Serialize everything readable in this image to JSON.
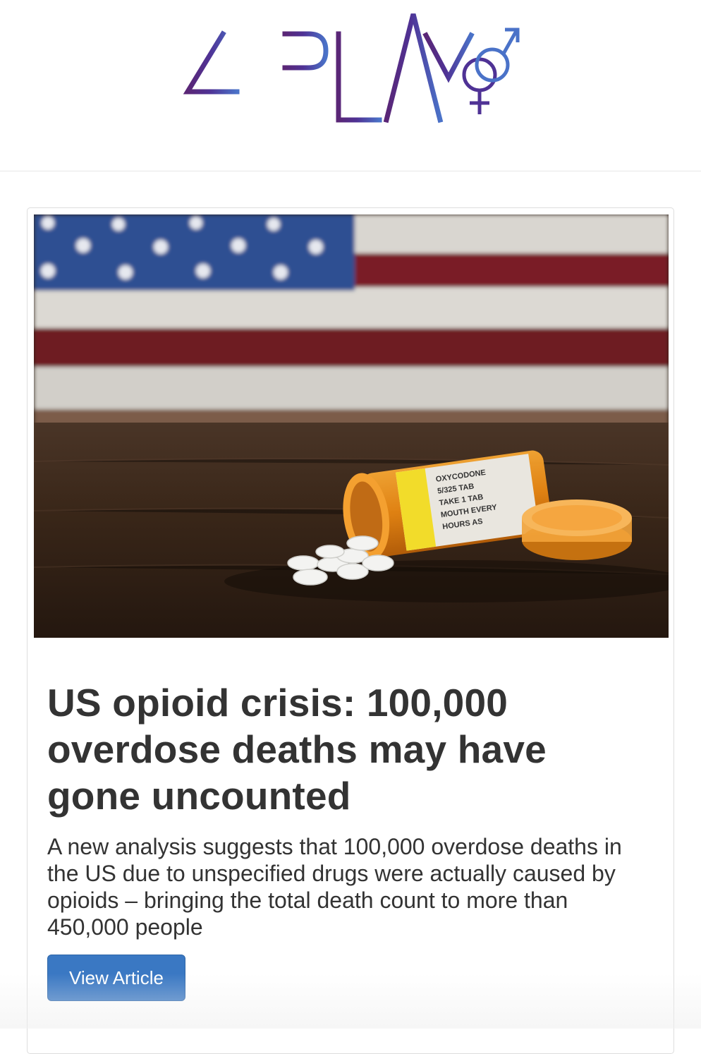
{
  "header": {
    "logo_text": "4PLAY",
    "brand_colors": {
      "purple": "#5a2676",
      "indigo": "#4a3a9e",
      "blue": "#4a72c8"
    }
  },
  "article": {
    "image_alt": "Spilled orange prescription pill bottle with white tablets on a wooden table in front of an American flag",
    "bottle_label": [
      "OXYCODONE",
      "5/325 TAB",
      "TAKE 1 TAB",
      "MOUTH EVERY",
      "HOURS AS"
    ],
    "title": "US opioid crisis: 100,000 overdose deaths may have gone uncounted",
    "summary": "A new analysis suggests that 100,000 overdose deaths in the US due to unspecified drugs were actually caused by opioids – bringing the total death count to more than 450,000 people",
    "button_label": "View Article",
    "button_color": "#3a78c3"
  }
}
